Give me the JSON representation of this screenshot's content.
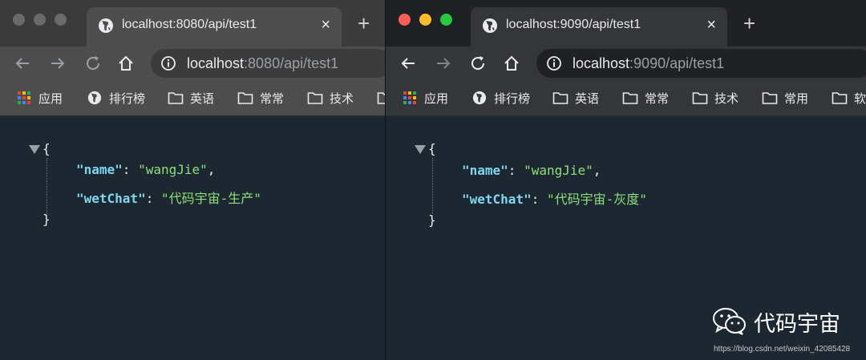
{
  "left_window": {
    "tab_title": "localhost:8080/api/test1",
    "tab_close": "×",
    "new_tab": "+",
    "url_host": "localhost",
    "url_rest": ":8080/api/test1",
    "bookmarks": [
      "应用",
      "排行榜",
      "英语",
      "常常",
      "技术"
    ],
    "json": {
      "open_brace": "{",
      "close_brace": "}",
      "entries": [
        {
          "key": "\"name\"",
          "value": "\"wangJie\"",
          "sep": ","
        },
        {
          "key": "\"wetChat\"",
          "value": "\"代码宇宙-生产\"",
          "sep": ""
        }
      ]
    }
  },
  "right_window": {
    "tab_title": "localhost:9090/api/test1",
    "tab_close": "×",
    "new_tab": "+",
    "url_host": "localhost",
    "url_rest": ":9090/api/test1",
    "bookmarks": [
      "应用",
      "排行榜",
      "英语",
      "常常",
      "技术",
      "常用",
      "软"
    ],
    "json": {
      "open_brace": "{",
      "close_brace": "}",
      "entries": [
        {
          "key": "\"name\"",
          "value": "\"wangJie\"",
          "sep": ","
        },
        {
          "key": "\"wetChat\"",
          "value": "\"代码宇宙-灰度\"",
          "sep": ""
        }
      ]
    }
  },
  "watermark": {
    "name": "代码宇宙",
    "url": "https://blog.csdn.net/weixin_42085428"
  },
  "colors": {
    "json_key": "#7fd6f0",
    "json_string": "#8be07a",
    "page_bg": "#1d2731"
  }
}
